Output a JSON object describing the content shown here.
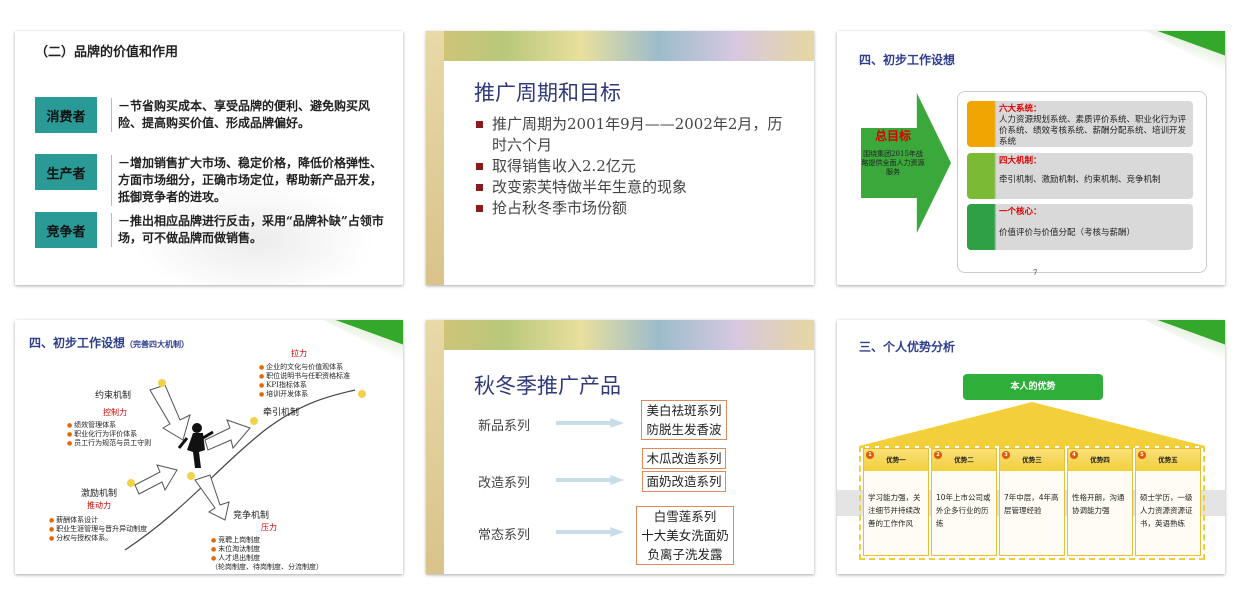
{
  "slide1": {
    "title": "（二）品牌的价值和作用",
    "rows": [
      {
        "label": "消费者",
        "text": "－节省购买成本、享受品牌的便利、避免购买风险、提高购买价值、形成品牌偏好。"
      },
      {
        "label": "生产者",
        "text": "－增加销售扩大市场、稳定价格，降低价格弹性、方面市场细分，正确市场定位，帮助新产品开发，抵御竞争者的进攻。"
      },
      {
        "label": "竞争者",
        "text": "－推出相应品牌进行反击，采用“品牌补缺”占领市场，可不做品牌而做销售。"
      }
    ]
  },
  "slide2": {
    "title": "推广周期和目标",
    "bullets": [
      "推广周期为2001年9月——2002年2月，历时六个月",
      "取得销售收入2.2亿元",
      "改变索芙特做半年生意的现象",
      "抢占秋冬季市场份额"
    ]
  },
  "slide3": {
    "title": "四、初步工作设想",
    "goal_title": "总目标",
    "goal_text": "围绕集团2015年战略提供全面人力资源服务",
    "rows": [
      {
        "head": "六大系统：",
        "body": "人力资源规划系统、素质评价系统、职业化行为评价系统、绩效考核系统、薪酬分配系统、培训开发系统"
      },
      {
        "head": "四大机制：",
        "body": "牵引机制、激励机制、约束机制、竞争机制"
      },
      {
        "head": "一个核心：",
        "body": "价值评价与价值分配（考核与薪酬）"
      }
    ],
    "page": "7"
  },
  "slide4": {
    "title": "四、初步工作设想",
    "subtitle": "（完善四大机制）",
    "top_force": "拉力",
    "top_items": [
      "企业的文化与价值观体系",
      "职位说明书与任职资格标准",
      "KPI指标体系",
      "培训开发体系"
    ],
    "pull_label": "牵引机制",
    "constrain_label": "约束机制",
    "control_force": "控制力",
    "constrain_items": [
      "绩效管理体系",
      "职业化行为评价体系",
      "员工行为规范与员工守则"
    ],
    "incentive_label": "激励机制",
    "push_force": "推动力",
    "incentive_items": [
      "薪酬体系设计",
      "职业生涯管理与晋升异动制度",
      "分权与授权体系。"
    ],
    "compete_label": "竞争机制",
    "pressure_force": "压力",
    "compete_items": [
      "竞聘上岗制度",
      "末位淘汰制度",
      "人才退出制度"
    ],
    "compete_note": "（轮岗制度、待岗制度、分流制度）"
  },
  "slide5": {
    "title": "秋冬季推广产品",
    "groups": [
      {
        "label": "新品系列",
        "items": [
          "美白祛斑系列",
          "防脱生发香波"
        ]
      },
      {
        "label": "改造系列",
        "items": [
          "木瓜改造系列",
          "面奶改造系列"
        ]
      },
      {
        "label": "常态系列",
        "items": [
          "白雪莲系列",
          "十大美女洗面奶",
          "负离子洗发露"
        ]
      }
    ]
  },
  "slide6": {
    "title": "三、个人优势分析",
    "banner": "本人的优势",
    "pillars": [
      {
        "num": "1",
        "head": "优势一",
        "text": "学习能力强，关注细节并持续改善的工作作风"
      },
      {
        "num": "2",
        "head": "优势二",
        "text": "10年上市公司或外企多行业的历练"
      },
      {
        "num": "3",
        "head": "优势三",
        "text": "7年中层，4年高层管理经验"
      },
      {
        "num": "4",
        "head": "优势四",
        "text": "性格开朗，沟通协调能力强"
      },
      {
        "num": "5",
        "head": "优势五",
        "text": "硕士学历，一级人力资源资源证书，英语熟练"
      }
    ]
  }
}
